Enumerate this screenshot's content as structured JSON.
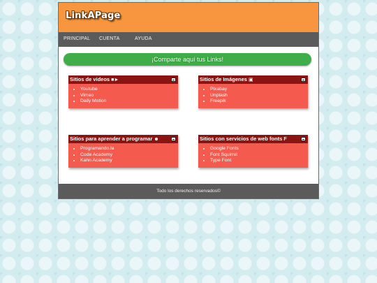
{
  "header": {
    "logo_text": "LinkAPage"
  },
  "nav": {
    "items": [
      "PRINCIPAL",
      "CUENTA",
      "AYUDA"
    ]
  },
  "banner": {
    "text": "¡Comparte aquí tus Links!"
  },
  "sections": [
    {
      "title": "Sitios de videos",
      "icon": "video-camera-icon",
      "links": [
        "Youtube",
        "Vimeo",
        "Daily Motion"
      ]
    },
    {
      "title": "Sitios de Imágenes",
      "icon": "camera-icon",
      "links": [
        "Pixabay",
        "Unplash",
        "Freepik"
      ]
    },
    {
      "title": "Sitios para aprender a programar",
      "icon": "emoji-icon",
      "links": [
        "Programando.la",
        "Code Academy",
        "Kahn Academy"
      ]
    },
    {
      "title": "Sitios con servicios de web fonts",
      "icon": "font-icon",
      "links": [
        "Google Fonts",
        "Font Squirrel",
        "Type Font"
      ]
    }
  ],
  "footer": {
    "text": "Todo los derechos reservados©"
  },
  "colors": {
    "header": "#f7963e",
    "nav": "#5b5b5b",
    "banner": "#3fae48",
    "box": "#f55a4e",
    "box_head": "#8a1412"
  }
}
